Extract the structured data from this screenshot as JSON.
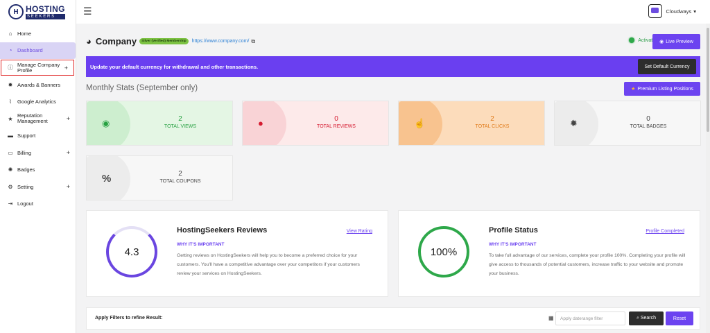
{
  "brand": {
    "logo_mark": "H",
    "name": "HOSTING",
    "tagline": "SEEKERS"
  },
  "topbar": {
    "user_name": "Cloudways",
    "user_caret": "▾",
    "menu_icon": "☰"
  },
  "sidebar": {
    "items": [
      {
        "label": "Home",
        "icon": "home-icon",
        "glyph": "⌂"
      },
      {
        "label": "Dashboard",
        "icon": "dashboard-icon",
        "glyph": "◔"
      },
      {
        "label": "Manage Company Profile",
        "icon": "info-icon",
        "glyph": "ⓘ",
        "expand": "+"
      },
      {
        "label": "Awards & Banners",
        "icon": "award-icon",
        "glyph": "✹"
      },
      {
        "label": "Google Analytics",
        "icon": "chart-icon",
        "glyph": "⌇"
      },
      {
        "label": "Reputation Management",
        "icon": "star-icon",
        "glyph": "★",
        "expand": "+"
      },
      {
        "label": "Support",
        "icon": "support-icon",
        "glyph": "▬"
      },
      {
        "label": "Billing",
        "icon": "billing-icon",
        "glyph": "▭",
        "expand": "+"
      },
      {
        "label": "Badges",
        "icon": "badge-icon",
        "glyph": "✺"
      },
      {
        "label": "Setting",
        "icon": "gear-icon",
        "glyph": "⚙",
        "expand": "+"
      },
      {
        "label": "Logout",
        "icon": "logout-icon",
        "glyph": "⇥"
      }
    ]
  },
  "header": {
    "title": "Company",
    "membership_badge": "Silver (Verified) Membership",
    "url": "https://www.company.com/",
    "status": "Activated",
    "preview_label": "Live Preview"
  },
  "banner": {
    "message": "Update your default currency for withdrawal and other transactions.",
    "button": "Set Default Currency"
  },
  "monthly": {
    "title": "Monthly Stats (September only)",
    "premium_button": "Premium Listing Positions"
  },
  "stats": [
    {
      "value": "2",
      "label": "TOTAL VIEWS",
      "icon": "eye-icon",
      "glyph": "◉"
    },
    {
      "value": "0",
      "label": "TOTAL REVIEWS",
      "icon": "comment-icon",
      "glyph": "●"
    },
    {
      "value": "2",
      "label": "TOTAL CLICKS",
      "icon": "pointer-icon",
      "glyph": "☝"
    },
    {
      "value": "0",
      "label": "TOTAL BADGES",
      "icon": "certificate-icon",
      "glyph": "✹"
    },
    {
      "value": "2",
      "label": "TOTAL COUPONS",
      "icon": "percent-icon",
      "glyph": "%"
    }
  ],
  "reviews_card": {
    "score": "4.3",
    "title": "HostingSeekers Reviews",
    "link": "View Rating",
    "subtitle": "WHY IT'S IMPORTANT",
    "body": "Getting reviews on HostingSeekers will help you to become a preferred choice for your customers. You'll have a competitive advantage over your competitors if your customers review your services on HostingSeekers."
  },
  "profile_card": {
    "percent": "100%",
    "title": "Profile Status",
    "link": "Profile Completed",
    "subtitle": "WHY IT'S IMPORTANT",
    "body": "To take full advantage of our services, complete your profile 100%. Completing your profile will give access to thousands of potential customers, increase traffic to your website and promote your business."
  },
  "filters": {
    "label": "Apply Filters to refine Result:",
    "date_placeholder": "Apply daterange filter",
    "search_button": "Search",
    "reset_button": "Reset"
  },
  "colors": {
    "accent": "#6c43f0",
    "views": "#e2f5e2",
    "reviews": "#fde8e8",
    "clicks": "#fbd9b6",
    "badges": "#f3f3f3",
    "coupons": "#f3f3f3"
  }
}
